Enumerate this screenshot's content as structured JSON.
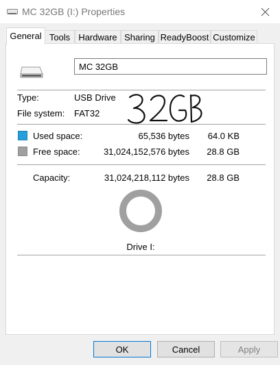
{
  "window": {
    "title": "MC 32GB (I:) Properties"
  },
  "tabs": [
    {
      "label": "General",
      "active": true
    },
    {
      "label": "Tools"
    },
    {
      "label": "Hardware"
    },
    {
      "label": "Sharing"
    },
    {
      "label": "ReadyBoost"
    },
    {
      "label": "Customize"
    }
  ],
  "volume": {
    "name_value": "MC 32GB"
  },
  "info": {
    "type_label": "Type:",
    "type_value": "USB Drive",
    "fs_label": "File system:",
    "fs_value": "FAT32",
    "handwritten_note": "32GB"
  },
  "usage": {
    "used": {
      "label": "Used space:",
      "bytes": "65,536 bytes",
      "size": "64.0 KB",
      "color": "#26a0da"
    },
    "free": {
      "label": "Free space:",
      "bytes": "31,024,152,576 bytes",
      "size": "28.8 GB",
      "color": "#a0a0a0"
    },
    "capacity": {
      "label": "Capacity:",
      "bytes": "31,024,218,112 bytes",
      "size": "28.8 GB"
    },
    "used_fraction": 2.1e-06
  },
  "drive_label": "Drive I:",
  "buttons": {
    "ok": "OK",
    "cancel": "Cancel",
    "apply": "Apply"
  },
  "icons": {
    "title": "usb-drive-icon",
    "close": "close-icon",
    "drive": "drive-icon"
  }
}
